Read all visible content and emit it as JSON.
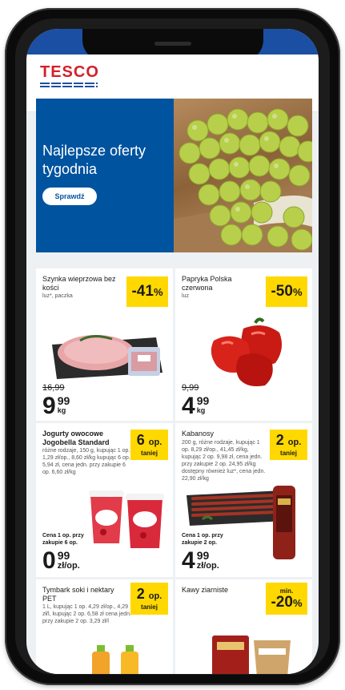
{
  "brand": {
    "name": "TESCO"
  },
  "hero": {
    "title": "Najlepsze oferty tygodnia",
    "button_label": "Sprawdź"
  },
  "products": [
    {
      "title": "Szynka wieprzowa bez kości",
      "desc": "luz*, paczka",
      "badge_value": "-41",
      "badge_unit": "%",
      "old_price": "16,99",
      "price_int": "9",
      "price_dec": "99",
      "price_unit": "kg"
    },
    {
      "title": "Papryka Polska czerwona",
      "desc": "luz",
      "badge_value": "-50",
      "badge_unit": "%",
      "old_price": "9,99",
      "price_int": "4",
      "price_dec": "99",
      "price_unit": "kg"
    },
    {
      "title": "Jogurty owocowe Jogobella Standard",
      "desc": "różne rodzaje, 150 g, kupując 1 op. 1,29 zł/op., 8,60 zł/kg kupując 6 op. 5,94 zł, cena jedn. przy zakupie 6 op. 6,60 zł/kg",
      "badge_value": "6",
      "badge_unit": "op.",
      "badge_sub": "taniej",
      "condition": "Cena 1 op. przy zakupie 6 op.",
      "price_int": "0",
      "price_dec": "99",
      "price_unit": "zł/op."
    },
    {
      "title": "Kabanosy",
      "desc": "200 g, różne rodzaje, kupując 1 op. 8,29 zł/op., 41,45 zł/kg, kupując 2 op. 9,98 zł, cena jedn. przy zakupie 2 op. 24,95 zł/kg dostępny również luz*, cena jedn. 22,90 zł/kg",
      "badge_value": "2",
      "badge_unit": "op.",
      "badge_sub": "taniej",
      "condition": "Cena 1 op. przy zakupie 2 op.",
      "price_int": "4",
      "price_dec": "99",
      "price_unit": "zł/op."
    },
    {
      "title": "Tymbark soki i nektary PET",
      "desc": "1 L, kupując 1 op. 4,29 zł/op., 4,29 zł/l, kupując 2 op. 6,58 zł cena jedn. przy zakupie 2 op. 3,29 zł/l",
      "badge_value": "2",
      "badge_unit": "op.",
      "badge_sub": "taniej"
    },
    {
      "title": "Kawy ziarniste",
      "badge_top": "min.",
      "badge_value": "-20",
      "badge_unit": "%"
    }
  ]
}
